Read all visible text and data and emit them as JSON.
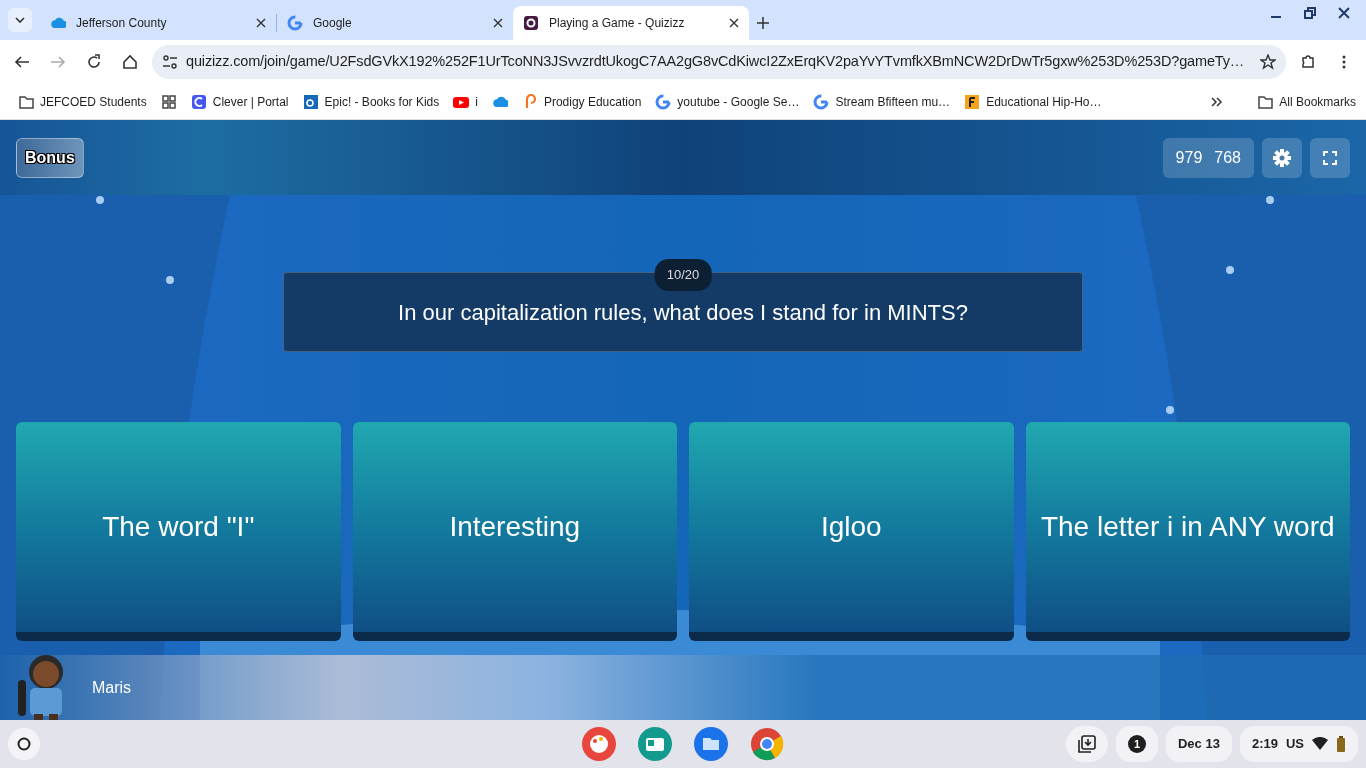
{
  "browser": {
    "tabs": [
      {
        "title": "Jefferson County",
        "selected": false
      },
      {
        "title": "Google",
        "selected": false
      },
      {
        "title": "Playing a Game - Quizizz",
        "selected": true
      }
    ],
    "address": "quizizz.com/join/game/U2FsdGVkX192%252F1UrTcoNN3JSvvzrdtUkogC7AA2gG8vCdKiwcI2ZxErqKV2paYvYTvmfkXBmNCW2DrDwTr5gxw%253D%253D?gameTy…",
    "bookmarks": [
      {
        "kind": "link",
        "label": "JEFCOED Students"
      },
      {
        "kind": "icon"
      },
      {
        "kind": "link",
        "label": "Clever | Portal"
      },
      {
        "kind": "link",
        "label": "Epic! - Books for Kids"
      },
      {
        "kind": "link",
        "label": "i"
      },
      {
        "kind": "icon"
      },
      {
        "kind": "link",
        "label": "Prodigy Education"
      },
      {
        "kind": "link",
        "label": "youtube - Google Se…"
      },
      {
        "kind": "link",
        "label": "Stream Bfifteen mu…"
      },
      {
        "kind": "link",
        "label": "Educational Hip-Ho…"
      }
    ],
    "all_bookmarks": "All Bookmarks"
  },
  "game": {
    "bonus": "Bonus",
    "scores": [
      "979",
      "768"
    ],
    "question": {
      "counter": "10/20",
      "text": "In our capitalization rules, what does I stand for in MINTS?"
    },
    "options": [
      {
        "text": "The word \"I\""
      },
      {
        "text": "Interesting"
      },
      {
        "text": "Igloo"
      },
      {
        "text": "The letter i in ANY word"
      }
    ],
    "player": {
      "name": "Maris"
    }
  },
  "shelf": {
    "notifications": "1",
    "date": "Dec 13",
    "time": "2:19",
    "locale": "US"
  }
}
